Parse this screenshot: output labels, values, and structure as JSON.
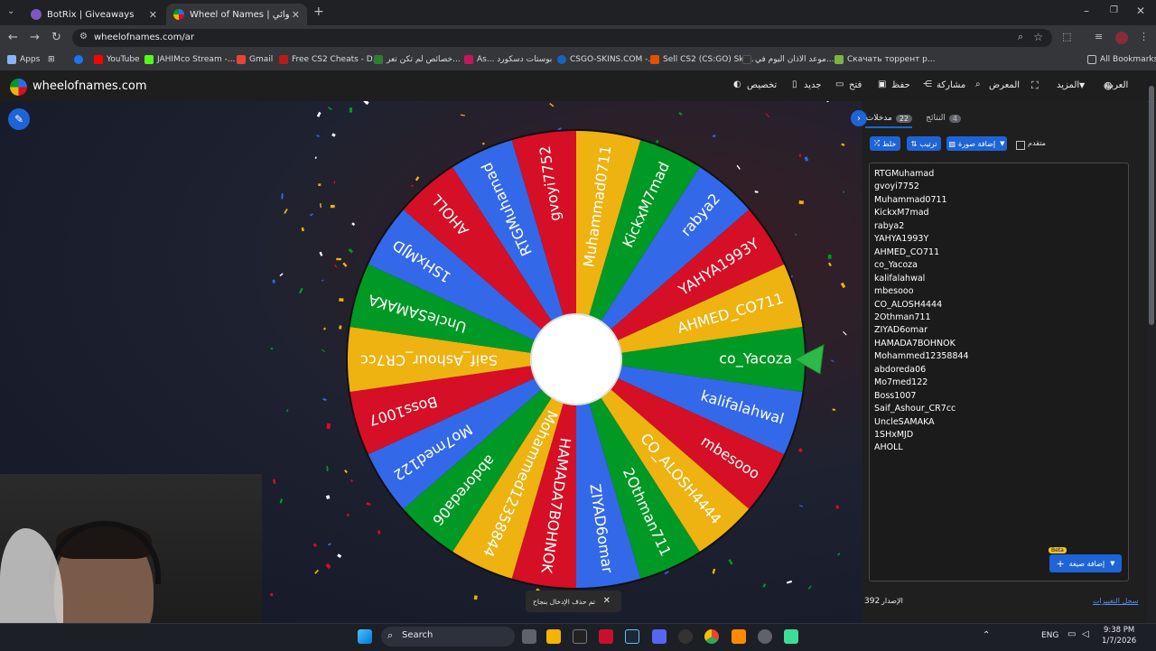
{
  "tabs": [
    {
      "title": "BotRix | Giveaways",
      "active": false
    },
    {
      "title": "Wheel of Names | العشوائي ...",
      "active": true
    }
  ],
  "new_tab": "+",
  "address": {
    "url": "wheelofnames.com/ar"
  },
  "bookmarks": {
    "items": [
      "Apps",
      "YouTube",
      "JAHIMco Stream -...",
      "Gmail",
      "Free CS2 Cheats - D...",
      "خصائص لم تكن تعر...",
      "As... بوستات دسكورد",
      "CSGO-SKINS.COM -...",
      "Sell CS2 (CS:GO) Ski...",
      "موعد الاذان اليوم في...",
      "Скачать торрент р..."
    ],
    "all": "All Bookmarks"
  },
  "site": {
    "brand": "wheelofnames.com",
    "nav": [
      "العربية",
      "المزيد",
      "المعرض",
      "مشاركة",
      "حفظ",
      "فتح",
      "جديد",
      "تخصيص"
    ]
  },
  "panel": {
    "tab_entries": "مدخلات",
    "entries_count": "22",
    "tab_results": "النتائج",
    "results_count": "4",
    "shuffle": "خلط",
    "sort": "ترتيب",
    "add_image": "إضافة صورة",
    "advanced": "متقدم",
    "add_entry": "إضافة صيغة",
    "beta": "Beta",
    "version_label": "الإصدار",
    "version": "392",
    "changelog": "سجل التغييرات"
  },
  "entries": [
    "RTGMuhamad",
    "gvoyi7752",
    "Muhammad0711",
    "KickxM7mad",
    "rabya2",
    "YAHYA1993Y",
    "AHMED_CO711",
    "co_Yacoza",
    "kalifalahwal",
    "mbesooo",
    "CO_ALOSH4444",
    "2Othman711",
    "ZIYAD6omar",
    "HAMADA7BOHNOK",
    "Mohammed12358844",
    "abdoreda06",
    "Mo7med122",
    "Boss1007",
    "Saif_Ashour_CR7cc",
    "UncleSAMAKA",
    "1SHxMJD",
    "AHOLL"
  ],
  "wheel": {
    "rotation_deg": 0,
    "colors": [
      "#3369e8",
      "#d50f25",
      "#eeb211",
      "#009925"
    ],
    "text_color": "#ffffff"
  },
  "toast": {
    "text": "تم حذف الإدخال بنجاح",
    "close": "✕"
  },
  "taskbar": {
    "search": "Search",
    "lang": "ENG",
    "time": "9:38 PM",
    "date": "1/7/2026"
  }
}
